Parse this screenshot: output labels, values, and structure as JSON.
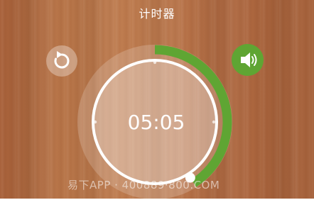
{
  "header": {
    "title": "计时器"
  },
  "timer": {
    "display": "05:05",
    "progress": 0.41
  },
  "controls": {
    "reset_icon": "reset-icon",
    "sound_icon": "speaker-on-icon"
  },
  "watermark": {
    "text": "易下APP · 400889·800.COM"
  },
  "colors": {
    "progress_arc": "#5fa533",
    "sound_button": "#5fa533",
    "ring": "#ffffff",
    "wood_base": "#b87548"
  }
}
